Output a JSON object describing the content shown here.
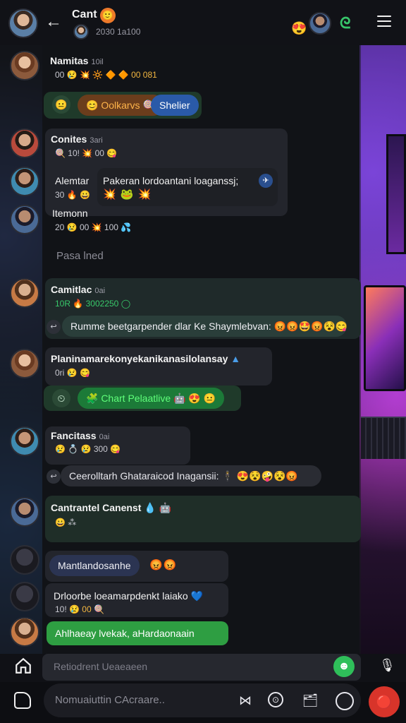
{
  "header": {
    "title": "Cant",
    "badge": "🙂",
    "subtitle": "2030 1a100",
    "reaction": "😍",
    "green_icon": "ᘓ"
  },
  "messages": [
    {
      "sender": "Namitas",
      "time": "10il",
      "meta": "00",
      "meta_emojis": "😢 💥 🔆 🔶 🔶",
      "meta_tail": "00 081",
      "reply_icon": "😐",
      "pills": [
        {
          "label": "😊 Oolkarvs 🍭",
          "style": "orange"
        },
        {
          "label": "Shelier",
          "style": "blue"
        }
      ]
    },
    {
      "sender": "Conites",
      "time": "3ari",
      "meta": "🍭 10! 💥 00 😋",
      "sub_sender": "Alemtar",
      "sub_meta": "30 🔥 😀",
      "bubble": "Pakeran lordoantani loaganssj;",
      "bubble_icon": "✈",
      "bubble_emojis": "💥 🐸 💥",
      "third_sender": "Itemonn",
      "third_meta": "20 😢 00 💥 100 💦"
    },
    {
      "divider": "Pasa lned"
    },
    {
      "sender": "Camitlac",
      "time": "0ai",
      "meta": "10R 🔥 3002250",
      "meta_icon": "◯",
      "bubble": "Rumme beetgarpender dlar Ke Shaymlebvan:",
      "bubble_emojis": "😡😡🤩😡😵😋"
    },
    {
      "sender": "Planinamarekonyekanikanasilolansay",
      "sender_icon": "▲",
      "meta": "0ri 😢 😋",
      "reply_icon": "⏲",
      "pill": "🧩 Chart Pelaatlive",
      "pill_emojis": "🤖 😍 😐"
    },
    {
      "sender": "Fancitass",
      "time": "0ai",
      "meta": "😢 💍 😢 300 😋",
      "bubble": "Ceerolltarh Ghataraicod Inagansii: 🕴",
      "bubble_emojis": "😍😵🤪😵😡"
    },
    {
      "sender": "Cantrantel Canenst",
      "sender_emojis": "💧 🤖",
      "meta": "😀 ⁂"
    },
    {
      "pill": "Mantlandosanhe",
      "pill_emojis": "😡😡",
      "sub_sender": "Drloorbe loeamarpdenkt laiako",
      "sub_icon": "💙",
      "sub_meta": "10!",
      "sub_meta_emojis": "😢 00 🍭"
    },
    {
      "pill": "Ahlhaeay lvekak, aHardaonaain"
    }
  ],
  "composer": {
    "reply_placeholder": "Retiodrent Ueaeaeen",
    "input_placeholder": "Nomuaiuttin CAcraare..",
    "send_icon": "🔴"
  }
}
